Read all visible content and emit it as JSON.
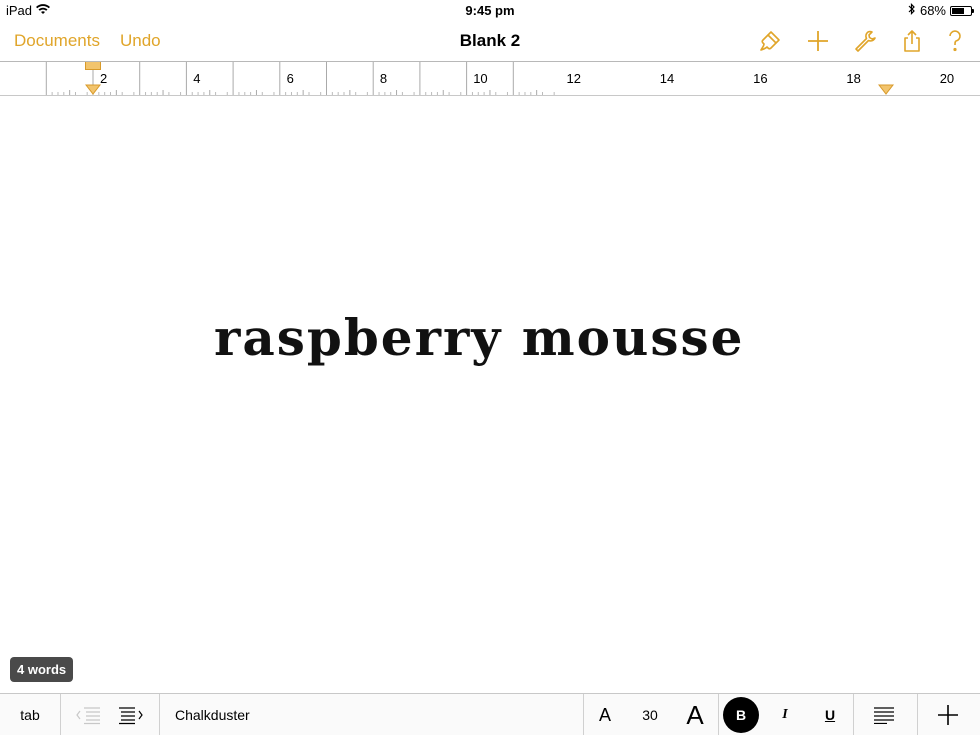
{
  "status": {
    "device": "iPad",
    "time": "9:45 pm",
    "battery": "68%",
    "battery_level": 0.68
  },
  "nav": {
    "documents_label": "Documents",
    "undo_label": "Undo",
    "title": "Blank 2",
    "accent": "#e0a52a"
  },
  "ruler": {
    "numbers": [
      "2",
      "4",
      "6",
      "8",
      "10",
      "12",
      "14",
      "16",
      "18",
      "20"
    ]
  },
  "document": {
    "text": "raspberry mousse"
  },
  "word_count": "4 words",
  "toolbar": {
    "tab_label": "tab",
    "font_name": "Chalkduster",
    "font_size": "30",
    "small_a": "A",
    "large_a": "A",
    "bold_label": "B",
    "italic_label": "I",
    "underline_label": "U"
  }
}
